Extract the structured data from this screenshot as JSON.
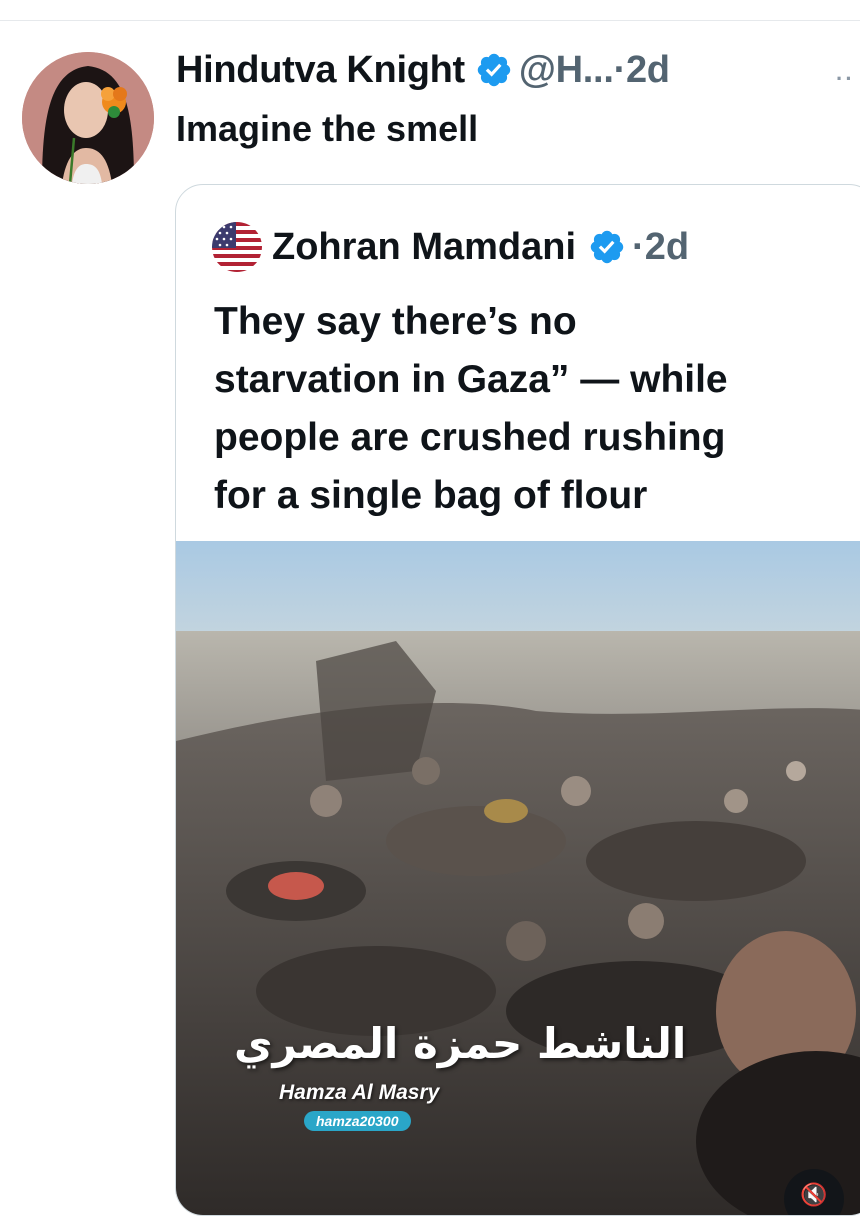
{
  "tweet": {
    "author_name": "Hindutva Knight",
    "handle": "@H...",
    "separator": "·",
    "time": "2d",
    "more": "··",
    "text": "Imagine the smell"
  },
  "quoted_tweet": {
    "author_name": "Zohran Mamdani",
    "separator": "·",
    "time": "2d",
    "text": "They say there’s no\nstarvation in Gaza” — while\npeople are crushed rushing\nfor a single bag of flour",
    "media": {
      "watermark_arabic": "الناشط حمزة المصري",
      "watermark_name": "Hamza Al Masry",
      "watermark_handle": "hamza20300"
    }
  },
  "colors": {
    "verified": "#1d9bf0",
    "secondary_text": "#536471",
    "border": "#cfd9de"
  },
  "icons": [
    "verified-badge-icon",
    "more-options-icon",
    "us-flag-icon",
    "mute-icon"
  ]
}
